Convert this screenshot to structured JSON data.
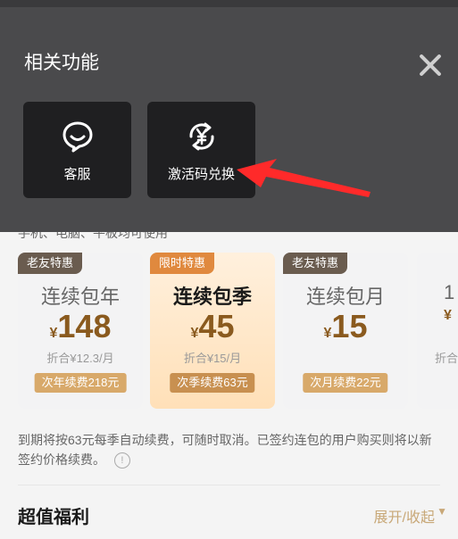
{
  "overlay": {
    "title": "相关功能",
    "functions": [
      {
        "label": "客服",
        "icon": "customer-service-icon"
      },
      {
        "label": "激活码兑换",
        "icon": "yen-exchange-icon"
      }
    ]
  },
  "page": {
    "subtitle": "手机、电脑、平板均可使用",
    "plans": [
      {
        "tag": "老友特惠",
        "name": "连续包年",
        "currency": "¥",
        "price": "148",
        "per": "折合¥12.3/月",
        "renew": "次年续费218元"
      },
      {
        "tag": "限时特惠",
        "name": "连续包季",
        "currency": "¥",
        "price": "45",
        "per": "折合¥15/月",
        "renew": "次季续费63元"
      },
      {
        "tag": "老友特惠",
        "name": "连续包月",
        "currency": "¥",
        "price": "15",
        "per": "",
        "renew": "次月续费22元"
      },
      {
        "tag": "",
        "name": "1",
        "currency": "¥",
        "price": "",
        "per": "折合",
        "renew": ""
      }
    ],
    "notice": "到期将按63元每季自动续费，可随时取消。已签约连包的用户购买则将以新签约价格续费。",
    "welfare_title": "超值福利",
    "expand_label": "展开/收起"
  },
  "colors": {
    "overlay": "#4a4a4c",
    "tile": "#1f1f21",
    "accent": "#ff2a2a",
    "gold": "#8a5a1e"
  }
}
